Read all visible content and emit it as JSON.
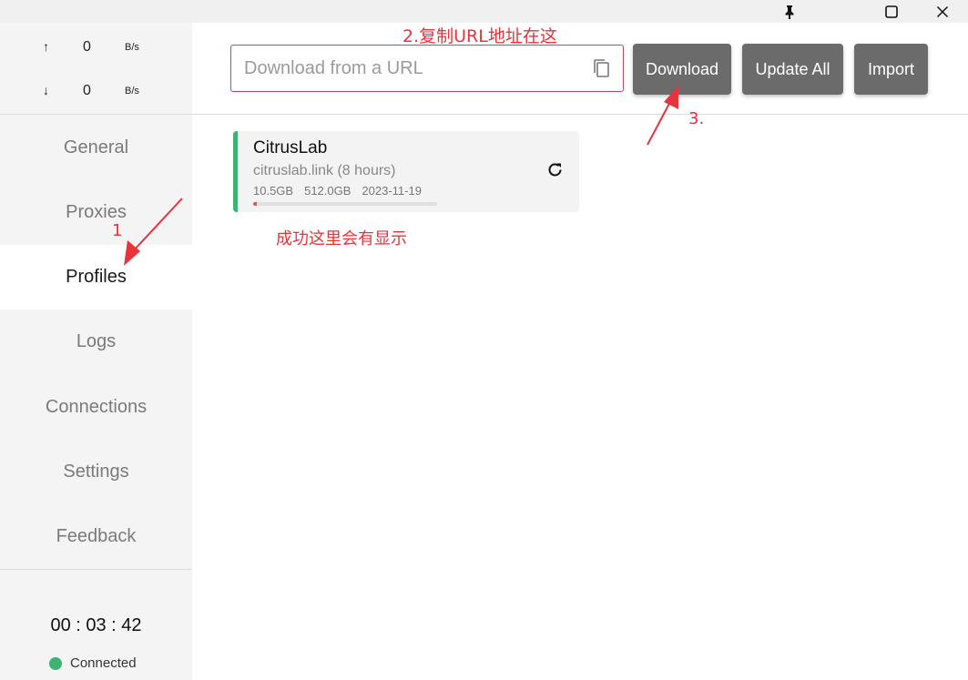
{
  "titlebar": {
    "pin_icon": "pin-icon",
    "maximize_icon": "maximize-icon",
    "close_icon": "close-icon"
  },
  "sidebar": {
    "traffic": {
      "up_arrow": "↑",
      "up_value": "0",
      "up_unit": "B/s",
      "down_arrow": "↓",
      "down_value": "0",
      "down_unit": "B/s"
    },
    "items": [
      {
        "label": "General"
      },
      {
        "label": "Proxies"
      },
      {
        "label": "Profiles"
      },
      {
        "label": "Logs"
      },
      {
        "label": "Connections"
      },
      {
        "label": "Settings"
      },
      {
        "label": "Feedback"
      }
    ],
    "active_item": "Profiles",
    "timer": "00 : 03 : 42",
    "status": {
      "label": "Connected",
      "color": "#3cb371"
    }
  },
  "header": {
    "url_input": {
      "placeholder": "Download from a URL",
      "value": ""
    },
    "download_label": "Download",
    "update_all_label": "Update All",
    "import_label": "Import"
  },
  "profiles": [
    {
      "name": "CitrusLab",
      "subtitle": "citruslab.link (8 hours)",
      "used": "10.5GB",
      "total": "512.0GB",
      "expire": "2023-11-19",
      "usage_fraction": 0.02,
      "accent_color": "#3cb371"
    }
  ],
  "annotations": {
    "step1": "1",
    "step2": "2.复制URL地址在这",
    "step3": "3.",
    "success_note": "成功这里会有显示",
    "color": "#e8323c"
  }
}
